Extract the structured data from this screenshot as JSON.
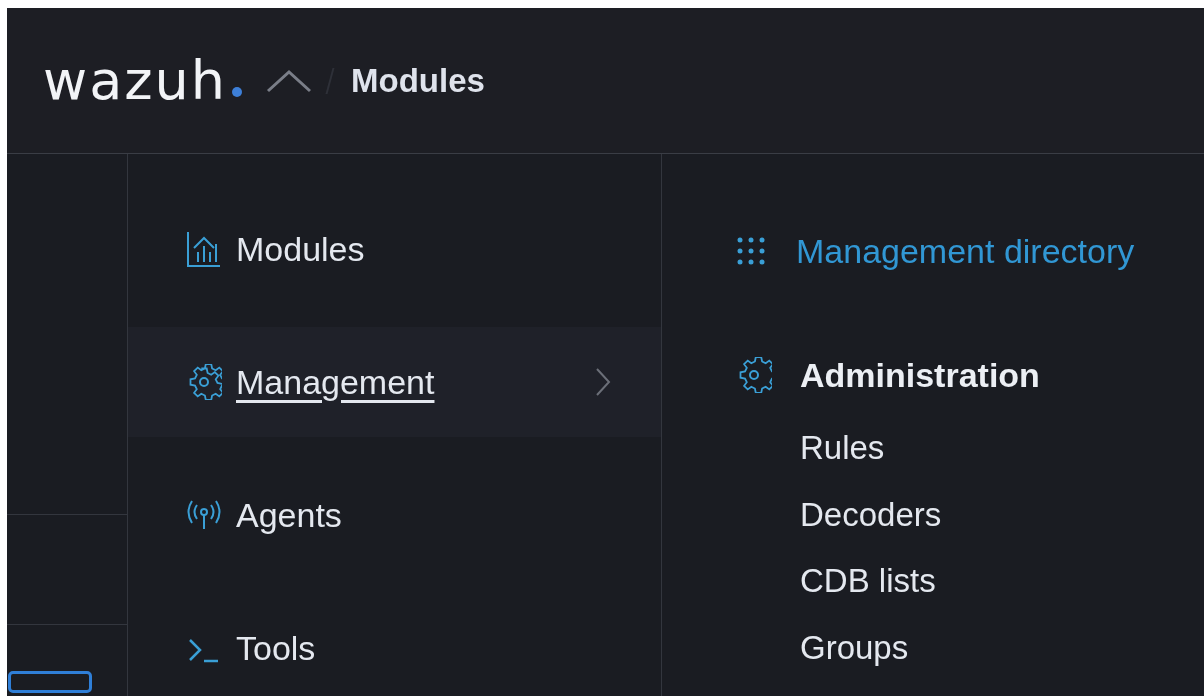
{
  "header": {
    "logo": "wazuh",
    "breadcrumb": "Modules"
  },
  "menu": [
    {
      "label": "Modules",
      "selected": false,
      "expandable": false
    },
    {
      "label": "Management",
      "selected": true,
      "expandable": true
    },
    {
      "label": "Agents",
      "selected": false,
      "expandable": false
    },
    {
      "label": "Tools",
      "selected": false,
      "expandable": false
    }
  ],
  "submenu": {
    "link": "Management directory",
    "section": {
      "title": "Administration",
      "items": [
        "Rules",
        "Decoders",
        "CDB lists",
        "Groups"
      ]
    }
  }
}
